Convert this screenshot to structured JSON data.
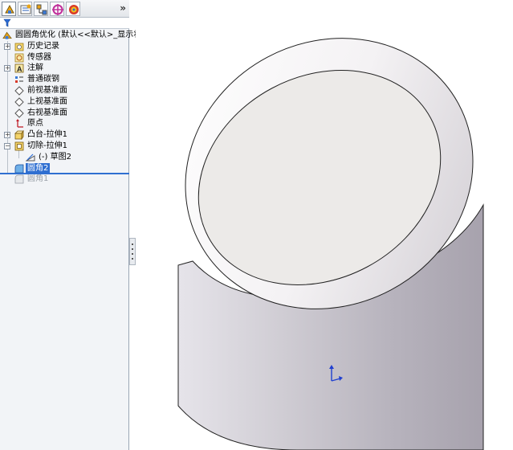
{
  "tabs": {
    "more_label": "»"
  },
  "tree": {
    "root_label": "圆圆角优化  (默认<<默认>_显示状",
    "items": [
      {
        "label": "历史记录"
      },
      {
        "label": "传感器"
      },
      {
        "label": "注解"
      },
      {
        "label": "普通碳钢"
      },
      {
        "label": "前视基准面"
      },
      {
        "label": "上视基准面"
      },
      {
        "label": "右视基准面"
      },
      {
        "label": "原点"
      },
      {
        "label": "凸台-拉伸1"
      },
      {
        "label": "切除-拉伸1"
      },
      {
        "label": "(-) 草图2"
      },
      {
        "label": "圆角2"
      },
      {
        "label": "圆角1"
      }
    ]
  },
  "colors": {
    "selection": "#2f6fd1",
    "part_body": "#d8d6dc",
    "face_top": "#eceae8"
  }
}
